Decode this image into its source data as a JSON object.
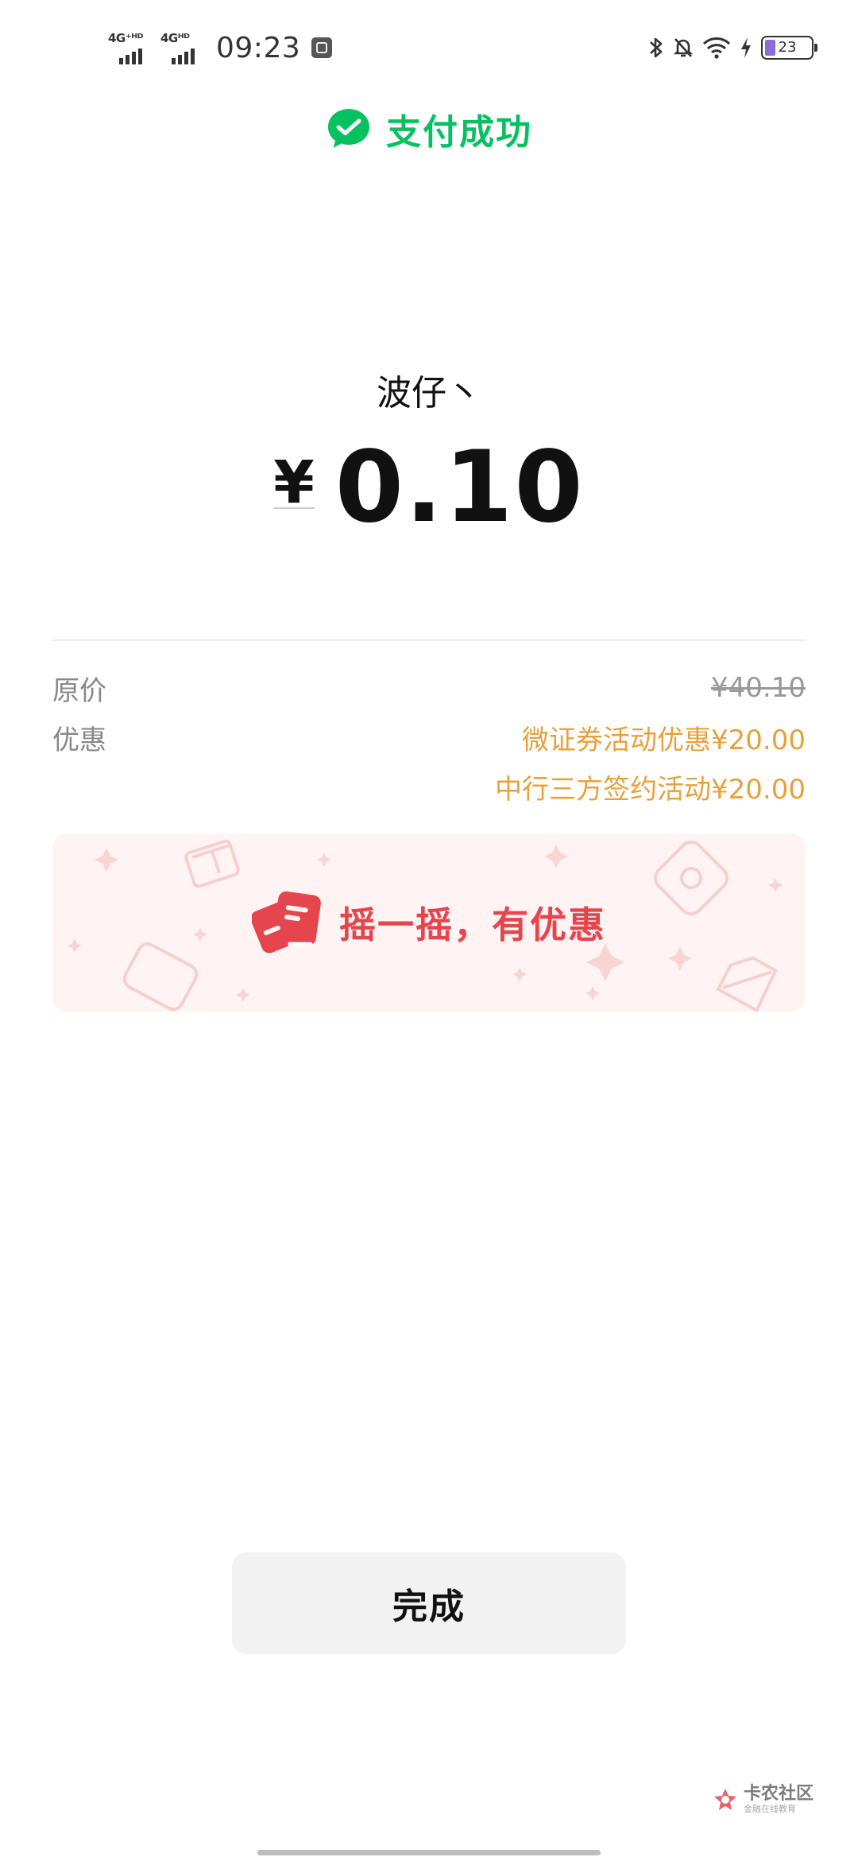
{
  "status_bar": {
    "network1": "4G⁺ᴴᴰ",
    "network2": "4Gᴴᴰ",
    "time": "09:23",
    "battery": "23",
    "battery_level": 0.23,
    "icons": [
      "bluetooth-icon",
      "mute-bell-icon",
      "wifi-icon",
      "charging-icon",
      "battery-icon"
    ]
  },
  "header": {
    "title": "支付成功",
    "icon": "wechat-pay-check-icon"
  },
  "payment": {
    "merchant": "波仔丶",
    "currency": "¥",
    "amount": "0.10"
  },
  "details": {
    "original_label": "原价",
    "original_price": "¥40.10",
    "discount_label": "优惠",
    "discounts": [
      "微证券活动优惠¥20.00",
      "中行三方签约活动¥20.00"
    ]
  },
  "banner": {
    "text": "摇一摇，有优惠",
    "icon": "shake-coupon-icon"
  },
  "actions": {
    "done_label": "完成"
  },
  "watermark": {
    "main": "卡农社区",
    "sub": "金融在线教育"
  },
  "colors": {
    "brand_green": "#07c160",
    "discount_orange": "#e8a13a",
    "banner_red": "#e5464d",
    "banner_bg": "#fff3f3"
  }
}
